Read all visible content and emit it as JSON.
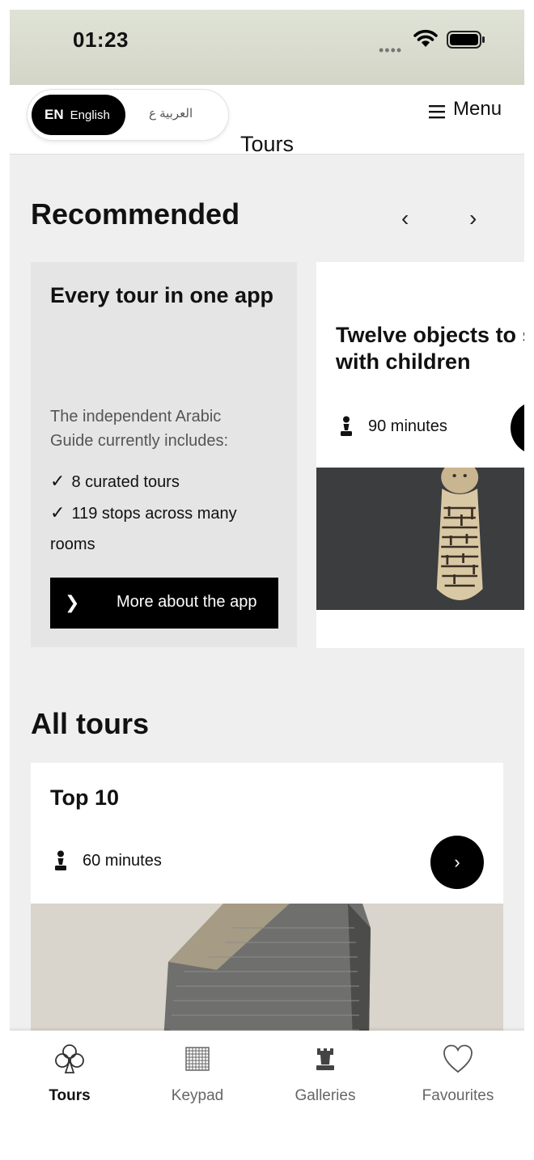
{
  "status_bar": {
    "time": "01:23",
    "signal_dots": "••••"
  },
  "header": {
    "lang_en_code": "EN",
    "lang_en_label": "English",
    "lang_ar_label": "العربية ع",
    "menu_label": "Menu",
    "page_title": "Tours"
  },
  "recommended": {
    "title": "Recommended",
    "prev": "‹",
    "next": "›",
    "intro_card": {
      "heading": "Every tour in one app",
      "description": "The independent Arabic Guide currently includes:",
      "items": [
        "8 curated tours",
        "119 stops across many rooms"
      ],
      "check": "✓",
      "button_icon": "❯",
      "button_label": "More about the app"
    },
    "tour_card": {
      "title_line1": "Twelve objects to s",
      "title_line2": "with children",
      "duration": "90 minutes",
      "icon": "pawn-icon"
    }
  },
  "all_tours": {
    "title": "All tours",
    "cards": [
      {
        "title": "Top 10",
        "duration": "60 minutes",
        "go": "›",
        "icon": "pawn-icon"
      }
    ]
  },
  "tab_bar": {
    "tabs": [
      {
        "label": "Tours",
        "icon": "club-icon",
        "active": true
      },
      {
        "label": "Keypad",
        "icon": "keypad-grid-icon",
        "active": false
      },
      {
        "label": "Galleries",
        "icon": "rook-icon",
        "active": false
      },
      {
        "label": "Favourites",
        "icon": "heart-icon",
        "active": false
      }
    ]
  },
  "colors": {
    "accent": "#000000",
    "page_bg": "#efefef",
    "card_intro_bg": "#e5e5e5",
    "status_bar_bg": "#d8dbcd"
  }
}
